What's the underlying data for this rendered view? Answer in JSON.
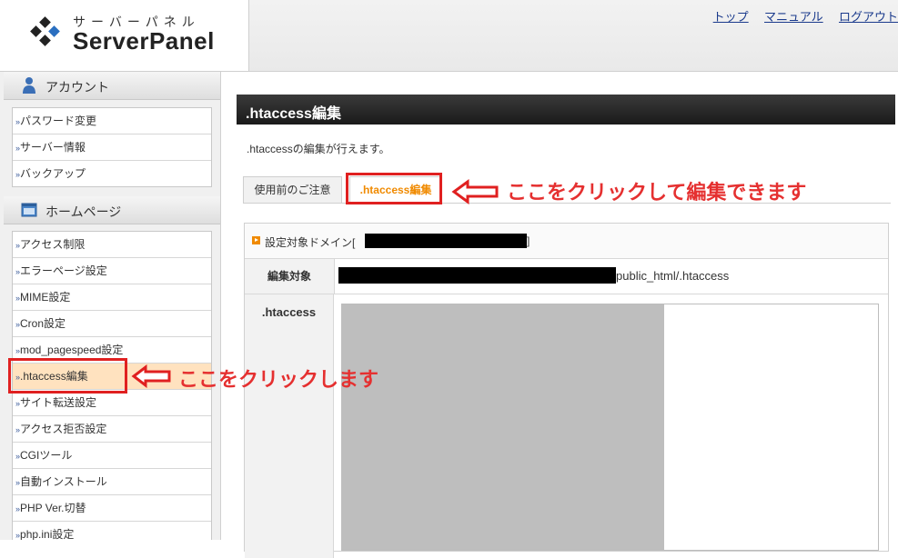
{
  "header": {
    "logo_kana": "サーバーパネル",
    "logo_text": "ServerPanel",
    "links": [
      "トップ",
      "マニュアル",
      "ログアウト"
    ]
  },
  "sidebar": {
    "account": {
      "title": "アカウント",
      "items": [
        "パスワード変更",
        "サーバー情報",
        "バックアップ"
      ]
    },
    "homepage": {
      "title": "ホームページ",
      "items": [
        "アクセス制限",
        "エラーページ設定",
        "MIME設定",
        "Cron設定",
        "mod_pagespeed設定",
        ".htaccess編集",
        "サイト転送設定",
        "アクセス拒否設定",
        "CGIツール",
        "自動インストール",
        "PHP Ver.切替",
        "php.ini設定"
      ],
      "active": ".htaccess編集"
    }
  },
  "main": {
    "title": ".htaccess編集",
    "description": ".htaccessの編集が行えます。",
    "tabs": [
      "使用前のご注意",
      ".htaccess編集"
    ],
    "panel": {
      "heading_prefix": "設定対象ドメイン[",
      "heading_suffix": "]",
      "row1_label": "編集対象",
      "row1_value": "public_html/.htaccess",
      "row2_label": ".htaccess"
    }
  },
  "annotations": {
    "tab_note": "ここをクリックして編集できます",
    "side_note": "ここをクリックします"
  },
  "colors": {
    "accent_orange": "#f08a00",
    "annotation_red": "#e02020",
    "link_blue": "#1a3a8c",
    "active_item_bg": "#ffe2bf"
  }
}
